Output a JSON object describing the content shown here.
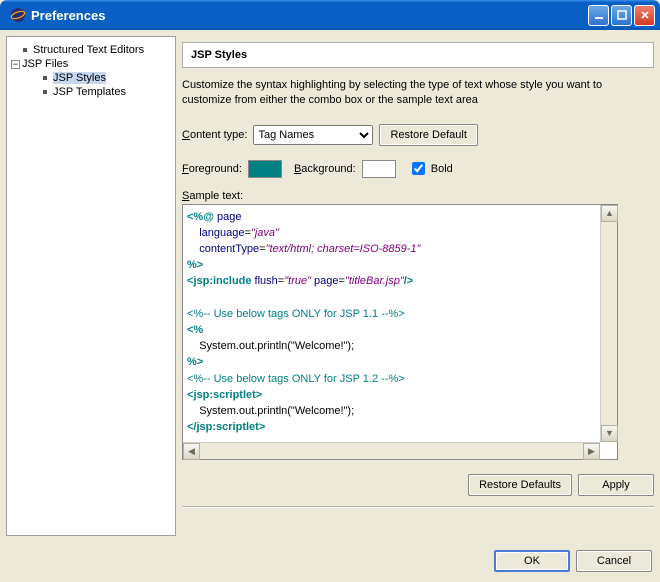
{
  "window": {
    "title": "Preferences"
  },
  "tree": {
    "items": [
      {
        "label": "Structured Text Editors"
      },
      {
        "label": "JSP Files"
      },
      {
        "label": "JSP Styles"
      },
      {
        "label": "JSP Templates"
      }
    ]
  },
  "header": {
    "title": "JSP Styles"
  },
  "desc": "Customize the syntax highlighting by selecting the type of text whose style you want to customize from either the combo box or the sample text area",
  "contentType": {
    "label": "Content type:",
    "value": "Tag Names"
  },
  "restoreDefault": "Restore Default",
  "foreground": {
    "label": "Foreground:"
  },
  "background": {
    "label": "Background:"
  },
  "bold": {
    "label": "Bold"
  },
  "sampleLabel": "Sample text:",
  "sample": {
    "l1a": "<%@",
    "l1b": " page",
    "l2a": "    language",
    "l2b": "=",
    "l2c": "\"java\"",
    "l3a": "    contentType",
    "l3b": "=",
    "l3c": "\"text/html; charset=ISO-8859-1\"",
    "l4": "%>",
    "l5a": "<",
    "l5b": "jsp:include",
    "l5c": " flush",
    "l5d": "=",
    "l5e": "\"true\"",
    "l5f": " page",
    "l5g": "=",
    "l5h": "\"titleBar.jsp\"",
    "l5i": "/>",
    "blank": "",
    "l6": "<%-- Use below tags ONLY for JSP 1.1 --%>",
    "l7": "<%",
    "l8": "    System.out.println(\"Welcome!\");",
    "l9": "%>",
    "l10": "<%-- Use below tags ONLY for JSP 1.2 --%>",
    "l11a": "<",
    "l11b": "jsp:scriptlet",
    "l11c": ">",
    "l12": "    System.out.println(\"Welcome!\");",
    "l13a": "</",
    "l13b": "jsp:scriptlet",
    "l13c": ">"
  },
  "buttons": {
    "restoreDefaults": "Restore Defaults",
    "apply": "Apply",
    "ok": "OK",
    "cancel": "Cancel"
  }
}
